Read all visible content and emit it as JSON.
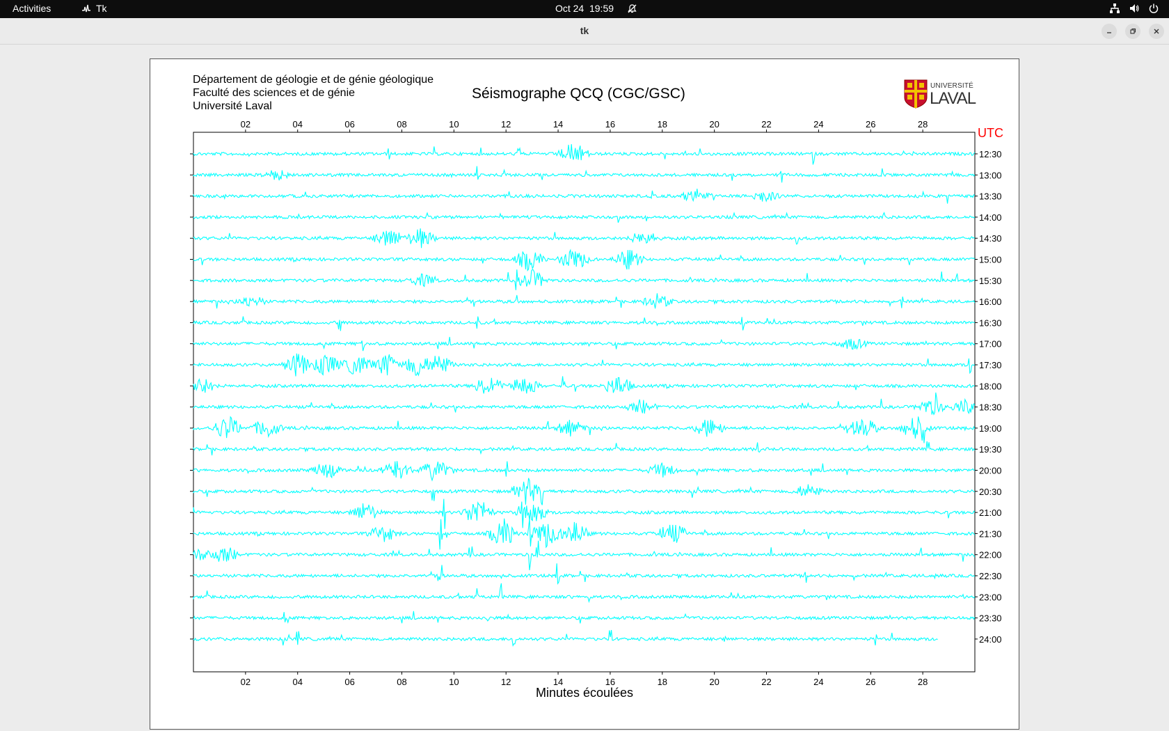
{
  "topbar": {
    "activities_label": "Activities",
    "app_label": "Tk",
    "date": "Oct 24",
    "time": "19:59"
  },
  "window": {
    "title": "tk"
  },
  "header": {
    "lines": [
      "Département de géologie et de génie géologique",
      "Faculté des sciences et de génie",
      "Université Laval"
    ],
    "title": "Séismographe QCQ (CGC/GSC)",
    "logo_line1": "UNIVERSITÉ",
    "logo_line2": "LAVAL"
  },
  "chart_data": {
    "type": "line",
    "title": "Séismographe QCQ (CGC/GSC)",
    "xlabel": "Minutes écoulées",
    "ylabel": "UTC",
    "x_ticks": [
      "02",
      "04",
      "06",
      "08",
      "10",
      "12",
      "14",
      "16",
      "18",
      "20",
      "22",
      "24",
      "26",
      "28"
    ],
    "xlim": [
      0,
      30
    ],
    "trace_color": "#00ffff",
    "axis_label_color": "#ff0000",
    "rows": [
      {
        "label": "12:30",
        "events": [
          {
            "m": 14.6,
            "a": 16
          }
        ],
        "spikes": [
          {
            "m": 7.5,
            "a": 14
          },
          {
            "m": 12.5,
            "a": 18
          },
          {
            "m": 23.8,
            "a": 16
          }
        ]
      },
      {
        "label": "13:00",
        "events": [
          {
            "m": 3.2,
            "a": 7
          }
        ],
        "spikes": [
          {
            "m": 10.9,
            "a": 13
          },
          {
            "m": 22.6,
            "a": 12
          }
        ]
      },
      {
        "label": "13:30",
        "events": [
          {
            "m": 19.3,
            "a": 10
          },
          {
            "m": 21.9,
            "a": 8
          }
        ],
        "spikes": [
          {
            "m": 17.6,
            "a": 12
          }
        ]
      },
      {
        "label": "14:00",
        "events": [],
        "spikes": [
          {
            "m": 16.3,
            "a": 10
          },
          {
            "m": 26.5,
            "a": 9
          }
        ]
      },
      {
        "label": "14:30",
        "events": [
          {
            "m": 7.5,
            "a": 15
          },
          {
            "m": 8.7,
            "a": 14
          },
          {
            "m": 17.3,
            "a": 10
          }
        ],
        "spikes": [
          {
            "m": 23.2,
            "a": 10
          }
        ]
      },
      {
        "label": "15:00",
        "events": [
          {
            "m": 12.9,
            "a": 16
          },
          {
            "m": 14.6,
            "a": 17
          },
          {
            "m": 16.7,
            "a": 14
          }
        ],
        "spikes": [
          {
            "m": 27.5,
            "a": 16
          }
        ]
      },
      {
        "label": "15:30",
        "events": [
          {
            "m": 13.0,
            "a": 14
          },
          {
            "m": 8.8,
            "a": 8
          }
        ],
        "spikes": [
          {
            "m": 28.7,
            "a": 18
          },
          {
            "m": 12.4,
            "a": 16
          }
        ]
      },
      {
        "label": "16:00",
        "events": [
          {
            "m": 17.8,
            "a": 10
          },
          {
            "m": 2.2,
            "a": 8
          }
        ],
        "spikes": [
          {
            "m": 12.4,
            "a": 14
          },
          {
            "m": 27.2,
            "a": 10
          }
        ]
      },
      {
        "label": "16:30",
        "events": [],
        "spikes": [
          {
            "m": 5.6,
            "a": 14
          },
          {
            "m": 10.9,
            "a": 12
          },
          {
            "m": 17.3,
            "a": 13
          },
          {
            "m": 21.1,
            "a": 12
          }
        ]
      },
      {
        "label": "17:00",
        "events": [
          {
            "m": 25.3,
            "a": 8
          }
        ],
        "spikes": [
          {
            "m": 6.5,
            "a": 12
          },
          {
            "m": 15.2,
            "a": 10
          }
        ]
      },
      {
        "label": "17:30",
        "events": [
          {
            "m": 4.0,
            "a": 17
          },
          {
            "m": 5.1,
            "a": 16
          },
          {
            "m": 6.3,
            "a": 16
          },
          {
            "m": 7.4,
            "a": 16
          },
          {
            "m": 8.6,
            "a": 17
          },
          {
            "m": 9.4,
            "a": 16
          }
        ],
        "spikes": [
          {
            "m": 29.8,
            "a": 14
          }
        ]
      },
      {
        "label": "18:00",
        "events": [
          {
            "m": 11.3,
            "a": 16
          },
          {
            "m": 12.7,
            "a": 15
          },
          {
            "m": 16.3,
            "a": 15
          },
          {
            "m": 0.3,
            "a": 12
          }
        ],
        "spikes": [
          {
            "m": 14.2,
            "a": 14
          }
        ]
      },
      {
        "label": "18:30",
        "events": [
          {
            "m": 17.2,
            "a": 10
          },
          {
            "m": 28.3,
            "a": 12
          },
          {
            "m": 29.6,
            "a": 10
          }
        ],
        "spikes": [
          {
            "m": 28.5,
            "a": 22
          }
        ]
      },
      {
        "label": "19:00",
        "events": [
          {
            "m": 1.3,
            "a": 18
          },
          {
            "m": 2.8,
            "a": 14
          },
          {
            "m": 14.5,
            "a": 12
          },
          {
            "m": 19.8,
            "a": 14
          },
          {
            "m": 25.7,
            "a": 16
          },
          {
            "m": 27.7,
            "a": 18
          }
        ],
        "spikes": [
          {
            "m": 28.0,
            "a": 22
          }
        ]
      },
      {
        "label": "19:30",
        "events": [],
        "spikes": [
          {
            "m": 21.7,
            "a": 14
          },
          {
            "m": 28.2,
            "a": 12
          }
        ]
      },
      {
        "label": "20:00",
        "events": [
          {
            "m": 5.1,
            "a": 12
          },
          {
            "m": 7.8,
            "a": 15
          },
          {
            "m": 9.3,
            "a": 16
          },
          {
            "m": 18.0,
            "a": 10
          }
        ],
        "spikes": [
          {
            "m": 12.0,
            "a": 14
          }
        ]
      },
      {
        "label": "20:30",
        "events": [
          {
            "m": 12.8,
            "a": 20
          },
          {
            "m": 23.6,
            "a": 10
          }
        ],
        "spikes": [
          {
            "m": 9.2,
            "a": 16
          },
          {
            "m": 13.4,
            "a": 20
          }
        ]
      },
      {
        "label": "21:00",
        "events": [
          {
            "m": 6.6,
            "a": 14
          },
          {
            "m": 10.9,
            "a": 20
          },
          {
            "m": 13.0,
            "a": 18
          }
        ],
        "spikes": [
          {
            "m": 9.6,
            "a": 24
          },
          {
            "m": 12.6,
            "a": 26
          }
        ]
      },
      {
        "label": "21:30",
        "events": [
          {
            "m": 11.9,
            "a": 22
          },
          {
            "m": 13.5,
            "a": 20
          },
          {
            "m": 14.6,
            "a": 18
          },
          {
            "m": 18.4,
            "a": 16
          },
          {
            "m": 7.3,
            "a": 12
          }
        ],
        "spikes": [
          {
            "m": 9.5,
            "a": 30
          },
          {
            "m": 12.9,
            "a": 34
          }
        ]
      },
      {
        "label": "22:00",
        "events": [
          {
            "m": 1.2,
            "a": 12
          },
          {
            "m": 0.4,
            "a": 8
          }
        ],
        "spikes": [
          {
            "m": 10.6,
            "a": 26
          },
          {
            "m": 12.9,
            "a": 30
          },
          {
            "m": 13.2,
            "a": 26
          }
        ]
      },
      {
        "label": "22:30",
        "events": [],
        "spikes": [
          {
            "m": 9.5,
            "a": 30
          },
          {
            "m": 11.8,
            "a": 20
          },
          {
            "m": 14.0,
            "a": 22
          },
          {
            "m": 23.5,
            "a": 12
          },
          {
            "m": 28.5,
            "a": 12
          }
        ]
      },
      {
        "label": "23:00",
        "events": [],
        "spikes": [
          {
            "m": 10.9,
            "a": 24
          },
          {
            "m": 11.8,
            "a": 20
          },
          {
            "m": 15.2,
            "a": 10
          },
          {
            "m": 29.5,
            "a": 10
          }
        ]
      },
      {
        "label": "23:30",
        "events": [],
        "spikes": [
          {
            "m": 3.5,
            "a": 12
          },
          {
            "m": 11.3,
            "a": 12
          },
          {
            "m": 12.1,
            "a": 8
          }
        ]
      },
      {
        "label": "24:00",
        "events": [],
        "spikes": [
          {
            "m": 4.0,
            "a": 12
          },
          {
            "m": 12.3,
            "a": 14
          },
          {
            "m": 16.0,
            "a": 14
          },
          {
            "m": 20.4,
            "a": 10
          },
          {
            "m": 26.2,
            "a": 10
          }
        ],
        "end_minute": 28.6
      }
    ]
  }
}
